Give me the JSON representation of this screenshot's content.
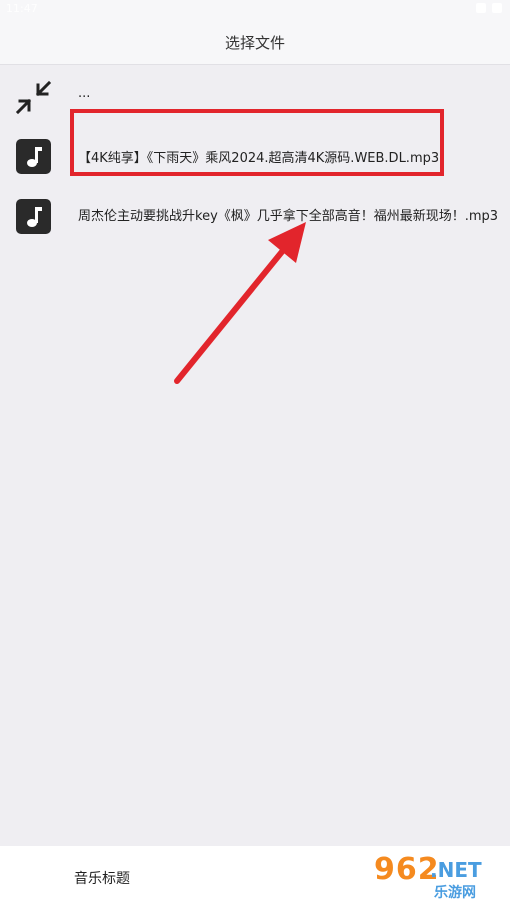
{
  "status_bar": {
    "time": "11:47"
  },
  "header": {
    "title": "选择文件"
  },
  "files": [
    {
      "icon": "collapse-icon",
      "name": "..."
    },
    {
      "icon": "music-note-icon",
      "name": "【4K纯享】《下雨天》乘风2024.超高清4K源码.WEB.DL.mp3"
    },
    {
      "icon": "music-note-icon",
      "name": "周杰伦主动要挑战升key《枫》几乎拿下全部高音！福州最新现场！.mp3"
    }
  ],
  "footer": {
    "label": "音乐标题"
  },
  "watermark": {
    "number": "962",
    "suffix": ".NET",
    "subtitle": "乐游网"
  },
  "colors": {
    "highlight": "#e2252c",
    "background": "#efeef2",
    "header": "#f7f7f9"
  }
}
